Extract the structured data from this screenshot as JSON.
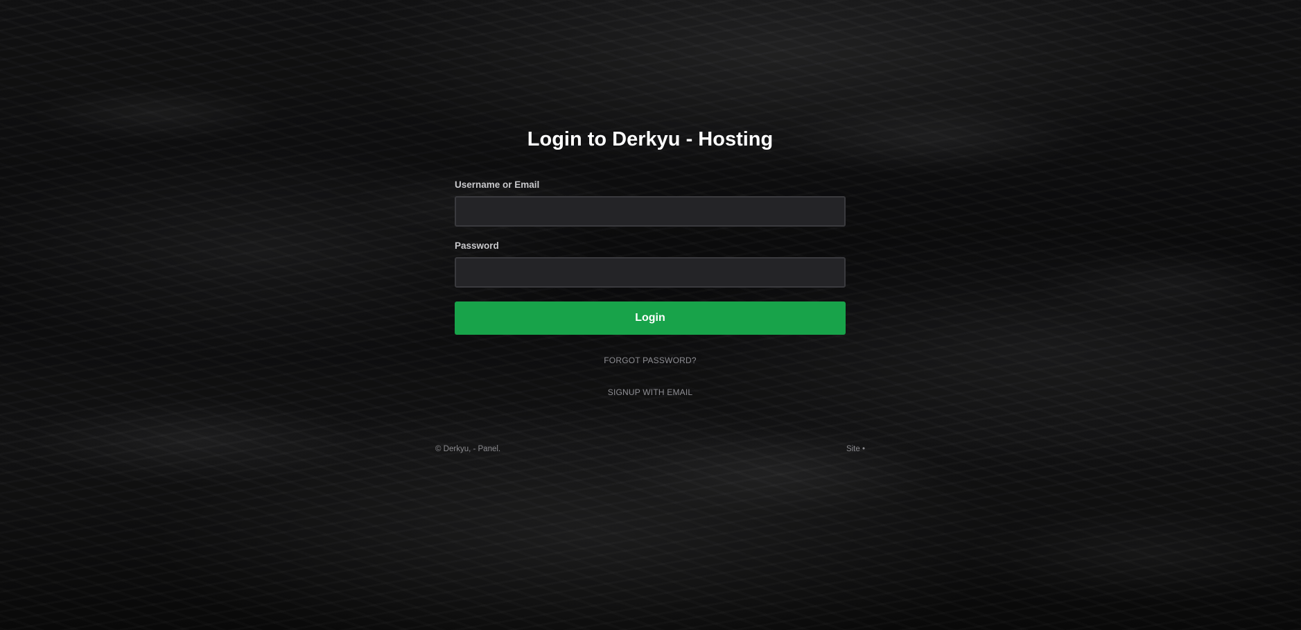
{
  "page": {
    "title": "Login to Derkyu - Hosting"
  },
  "form": {
    "username": {
      "label": "Username or Email",
      "value": "",
      "placeholder": ""
    },
    "password": {
      "label": "Password",
      "value": "",
      "placeholder": ""
    },
    "submit_label": "Login"
  },
  "links": {
    "forgot_password": "FORGOT PASSWORD?",
    "signup": "SIGNUP WITH EMAIL"
  },
  "footer": {
    "copyright": "© Derkyu, - Panel.",
    "site_link": "Site",
    "separator": "•"
  },
  "colors": {
    "background": "#0c0c0d",
    "input_background": "#242427",
    "input_border": "#3a3a3e",
    "button": "#18a34a",
    "title": "#ffffff",
    "muted_text": "#8e8e93"
  }
}
